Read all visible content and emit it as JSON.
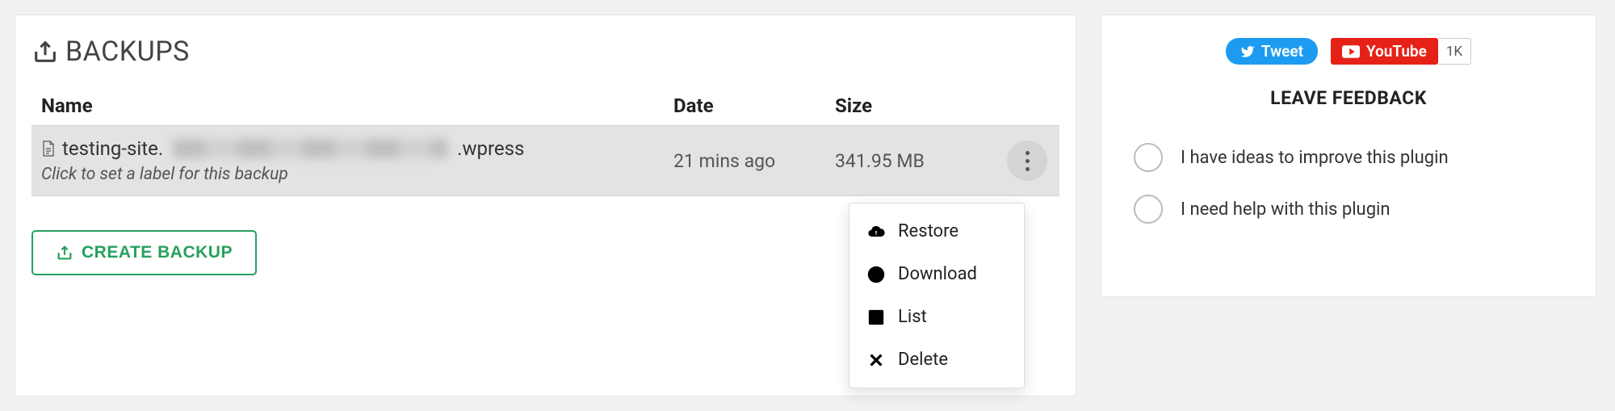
{
  "panel": {
    "title": "BACKUPS",
    "columns": {
      "name": "Name",
      "date": "Date",
      "size": "Size"
    },
    "create_label": "CREATE BACKUP"
  },
  "backup": {
    "filename_prefix": "testing-site.",
    "filename_suffix": ".wpress",
    "label_hint": "Click to set a label for this backup",
    "date": "21 mins ago",
    "size": "341.95 MB"
  },
  "menu": {
    "restore": "Restore",
    "download": "Download",
    "list": "List",
    "delete": "Delete"
  },
  "side": {
    "tweet": "Tweet",
    "youtube": "YouTube",
    "youtube_count": "1K",
    "feedback_title": "LEAVE FEEDBACK",
    "opt_ideas": "I have ideas to improve this plugin",
    "opt_help": "I need help with this plugin"
  }
}
